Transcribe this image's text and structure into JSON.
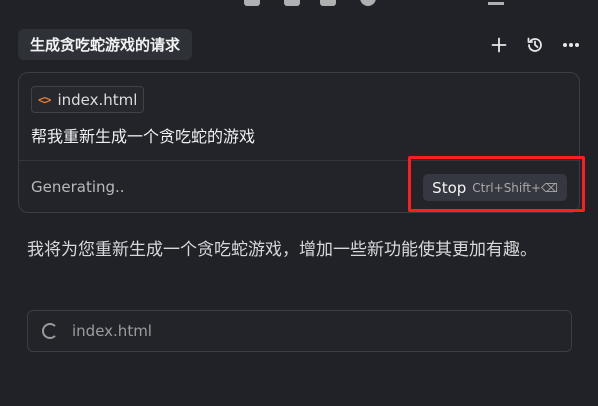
{
  "header": {
    "title": "生成贪吃蛇游戏的请求",
    "actions": [
      "plus-icon",
      "history-icon",
      "more-icon"
    ]
  },
  "prompt_card": {
    "file_chip": {
      "icon": "code-icon",
      "label": "index.html"
    },
    "prompt": "帮我重新生成一个贪吃蛇的游戏",
    "status": "Generating..",
    "stop_button": {
      "label": "Stop",
      "shortcut": "Ctrl+Shift+⌫"
    }
  },
  "response": {
    "text": "我将为您重新生成一个贪吃蛇游戏，增加一些新功能使其更加有趣。"
  },
  "file_row": {
    "icon": "spinner-icon",
    "label": "index.html"
  },
  "colors": {
    "background": "#202228",
    "highlight": "#ff1d1d",
    "code_icon": "#e07b3b"
  }
}
